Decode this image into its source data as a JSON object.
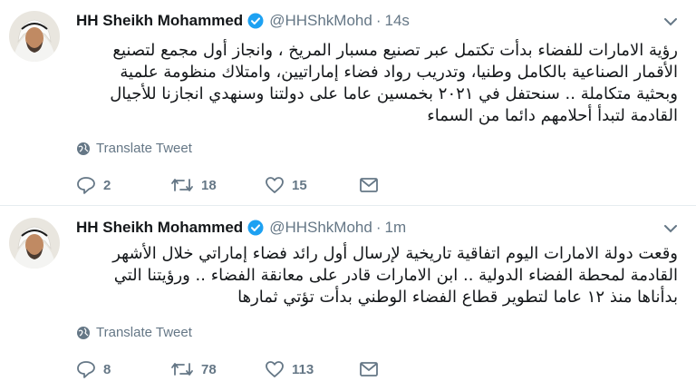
{
  "tweets": [
    {
      "name": "HH Sheikh Mohammed",
      "handle": "@HHShkMohd",
      "separator": "·",
      "time": "14s",
      "lines": [
        "رؤية الامارات للفضاء بدأت تكتمل عبر تصنيع مسبار المريخ ، وانجاز أول مجمع لتصنيع",
        "الأقمار الصناعية بالكامل وطنيا، وتدريب رواد فضاء إماراتيين، وامتلاك منظومة علمية",
        "وبحثية متكاملة .. سنحتفل في ٢٠٢١ بخمسين عاما على دولتنا وسنهدي انجازنا للأجيال",
        "القادمة لتبدأ أحلامهم دائما من السماء"
      ],
      "translate": "Translate Tweet",
      "replies": "2",
      "retweets": "18",
      "likes": "15"
    },
    {
      "name": "HH Sheikh Mohammed",
      "handle": "@HHShkMohd",
      "separator": "·",
      "time": "1m",
      "lines": [
        "وقعت دولة الامارات اليوم اتفاقية تاريخية لإرسال أول رائد فضاء إماراتي خلال الأشهر",
        "القادمة لمحطة الفضاء الدولية .. ابن الامارات قادر على معانقة الفضاء .. ورؤيتنا التي",
        "بدأناها منذ ١٢ عاما لتطوير قطاع الفضاء الوطني بدأت تؤتي ثمارها"
      ],
      "translate": "Translate Tweet",
      "replies": "8",
      "retweets": "78",
      "likes": "113"
    }
  ],
  "icons": {
    "verified": "verified-badge-icon",
    "caret": "chevron-down-icon",
    "globe": "globe-icon",
    "reply": "reply-icon",
    "retweet": "retweet-icon",
    "like": "heart-icon",
    "dm": "envelope-icon"
  },
  "colors": {
    "accent": "#1da1f2",
    "muted": "#657786",
    "text": "#14171a",
    "divider": "#e6ecf0"
  }
}
